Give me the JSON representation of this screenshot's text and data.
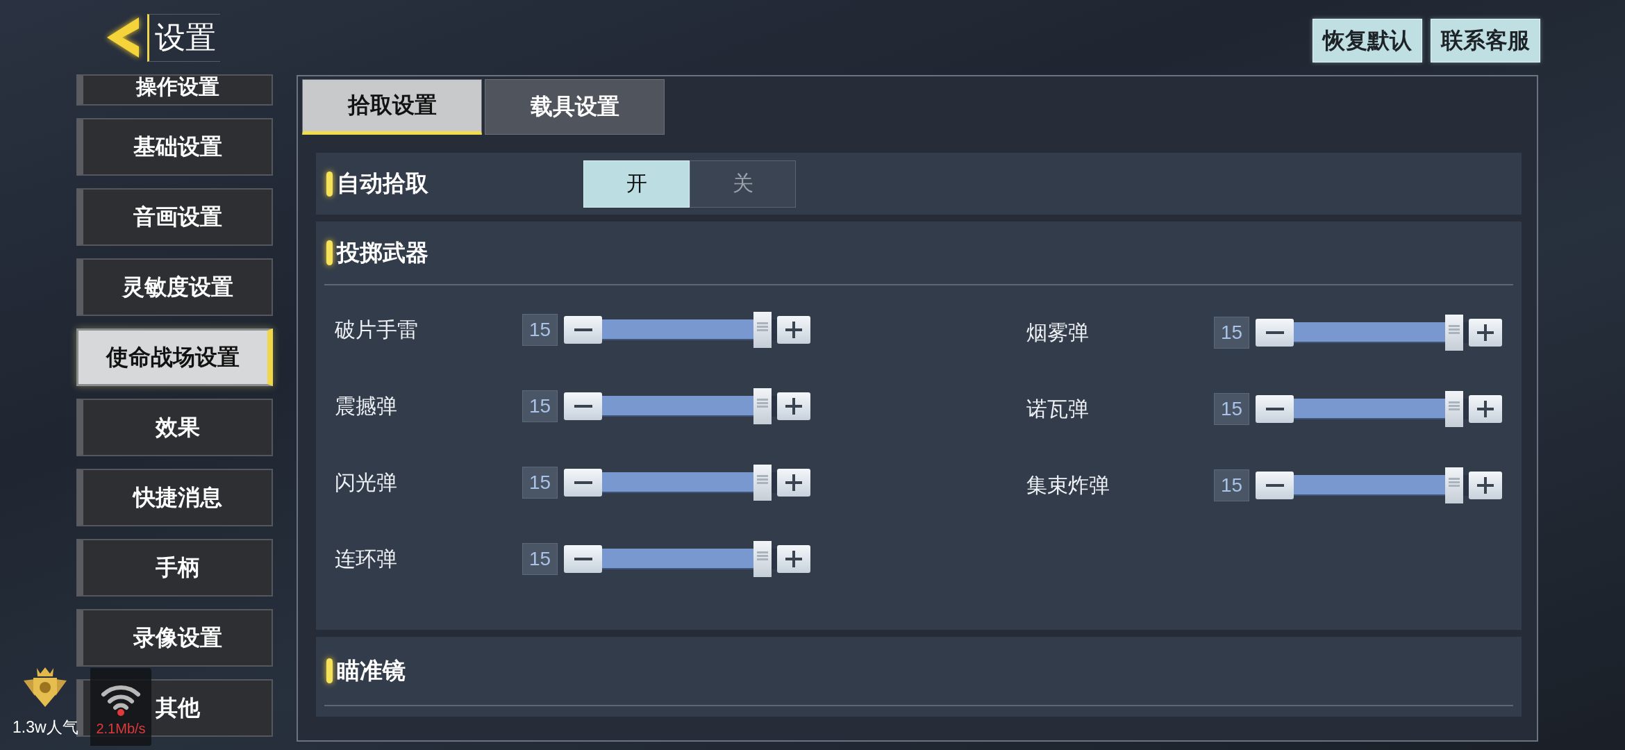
{
  "header": {
    "title": "设置"
  },
  "top_buttons": [
    "恢复默认",
    "联系客服"
  ],
  "sidebar": {
    "items": [
      {
        "label": "操作设置",
        "selected": false
      },
      {
        "label": "基础设置",
        "selected": false
      },
      {
        "label": "音画设置",
        "selected": false
      },
      {
        "label": "灵敏度设置",
        "selected": false
      },
      {
        "label": "使命战场设置",
        "selected": true
      },
      {
        "label": "效果",
        "selected": false
      },
      {
        "label": "快捷消息",
        "selected": false
      },
      {
        "label": "手柄",
        "selected": false
      },
      {
        "label": "录像设置",
        "selected": false
      },
      {
        "label": "其他",
        "selected": false
      }
    ]
  },
  "tabs": [
    {
      "label": "拾取设置",
      "selected": true
    },
    {
      "label": "载具设置",
      "selected": false
    }
  ],
  "sections": [
    {
      "kind": "toggle",
      "title": "自动拾取",
      "options": [
        {
          "label": "开",
          "selected": true
        },
        {
          "label": "关",
          "selected": false
        }
      ]
    },
    {
      "kind": "sliders",
      "title": "投掷武器",
      "columns": [
        [
          {
            "name": "破片手雷",
            "value": "15",
            "level": 0.97
          },
          {
            "name": "震撼弹",
            "value": "15",
            "level": 0.97
          },
          {
            "name": "闪光弹",
            "value": "15",
            "level": 0.97
          },
          {
            "name": "连环弹",
            "value": "15",
            "level": 0.97
          }
        ],
        [
          {
            "name": "烟雾弹",
            "value": "15",
            "level": 0.97
          },
          {
            "name": "诺瓦弹",
            "value": "15",
            "level": 0.97
          },
          {
            "name": "集束炸弹",
            "value": "15",
            "level": 0.97
          }
        ]
      ]
    },
    {
      "kind": "header",
      "title": "瞄准镜"
    }
  ],
  "overlay": {
    "popularity": "1.3w人气",
    "network_speed": "2.1Mb/s"
  }
}
